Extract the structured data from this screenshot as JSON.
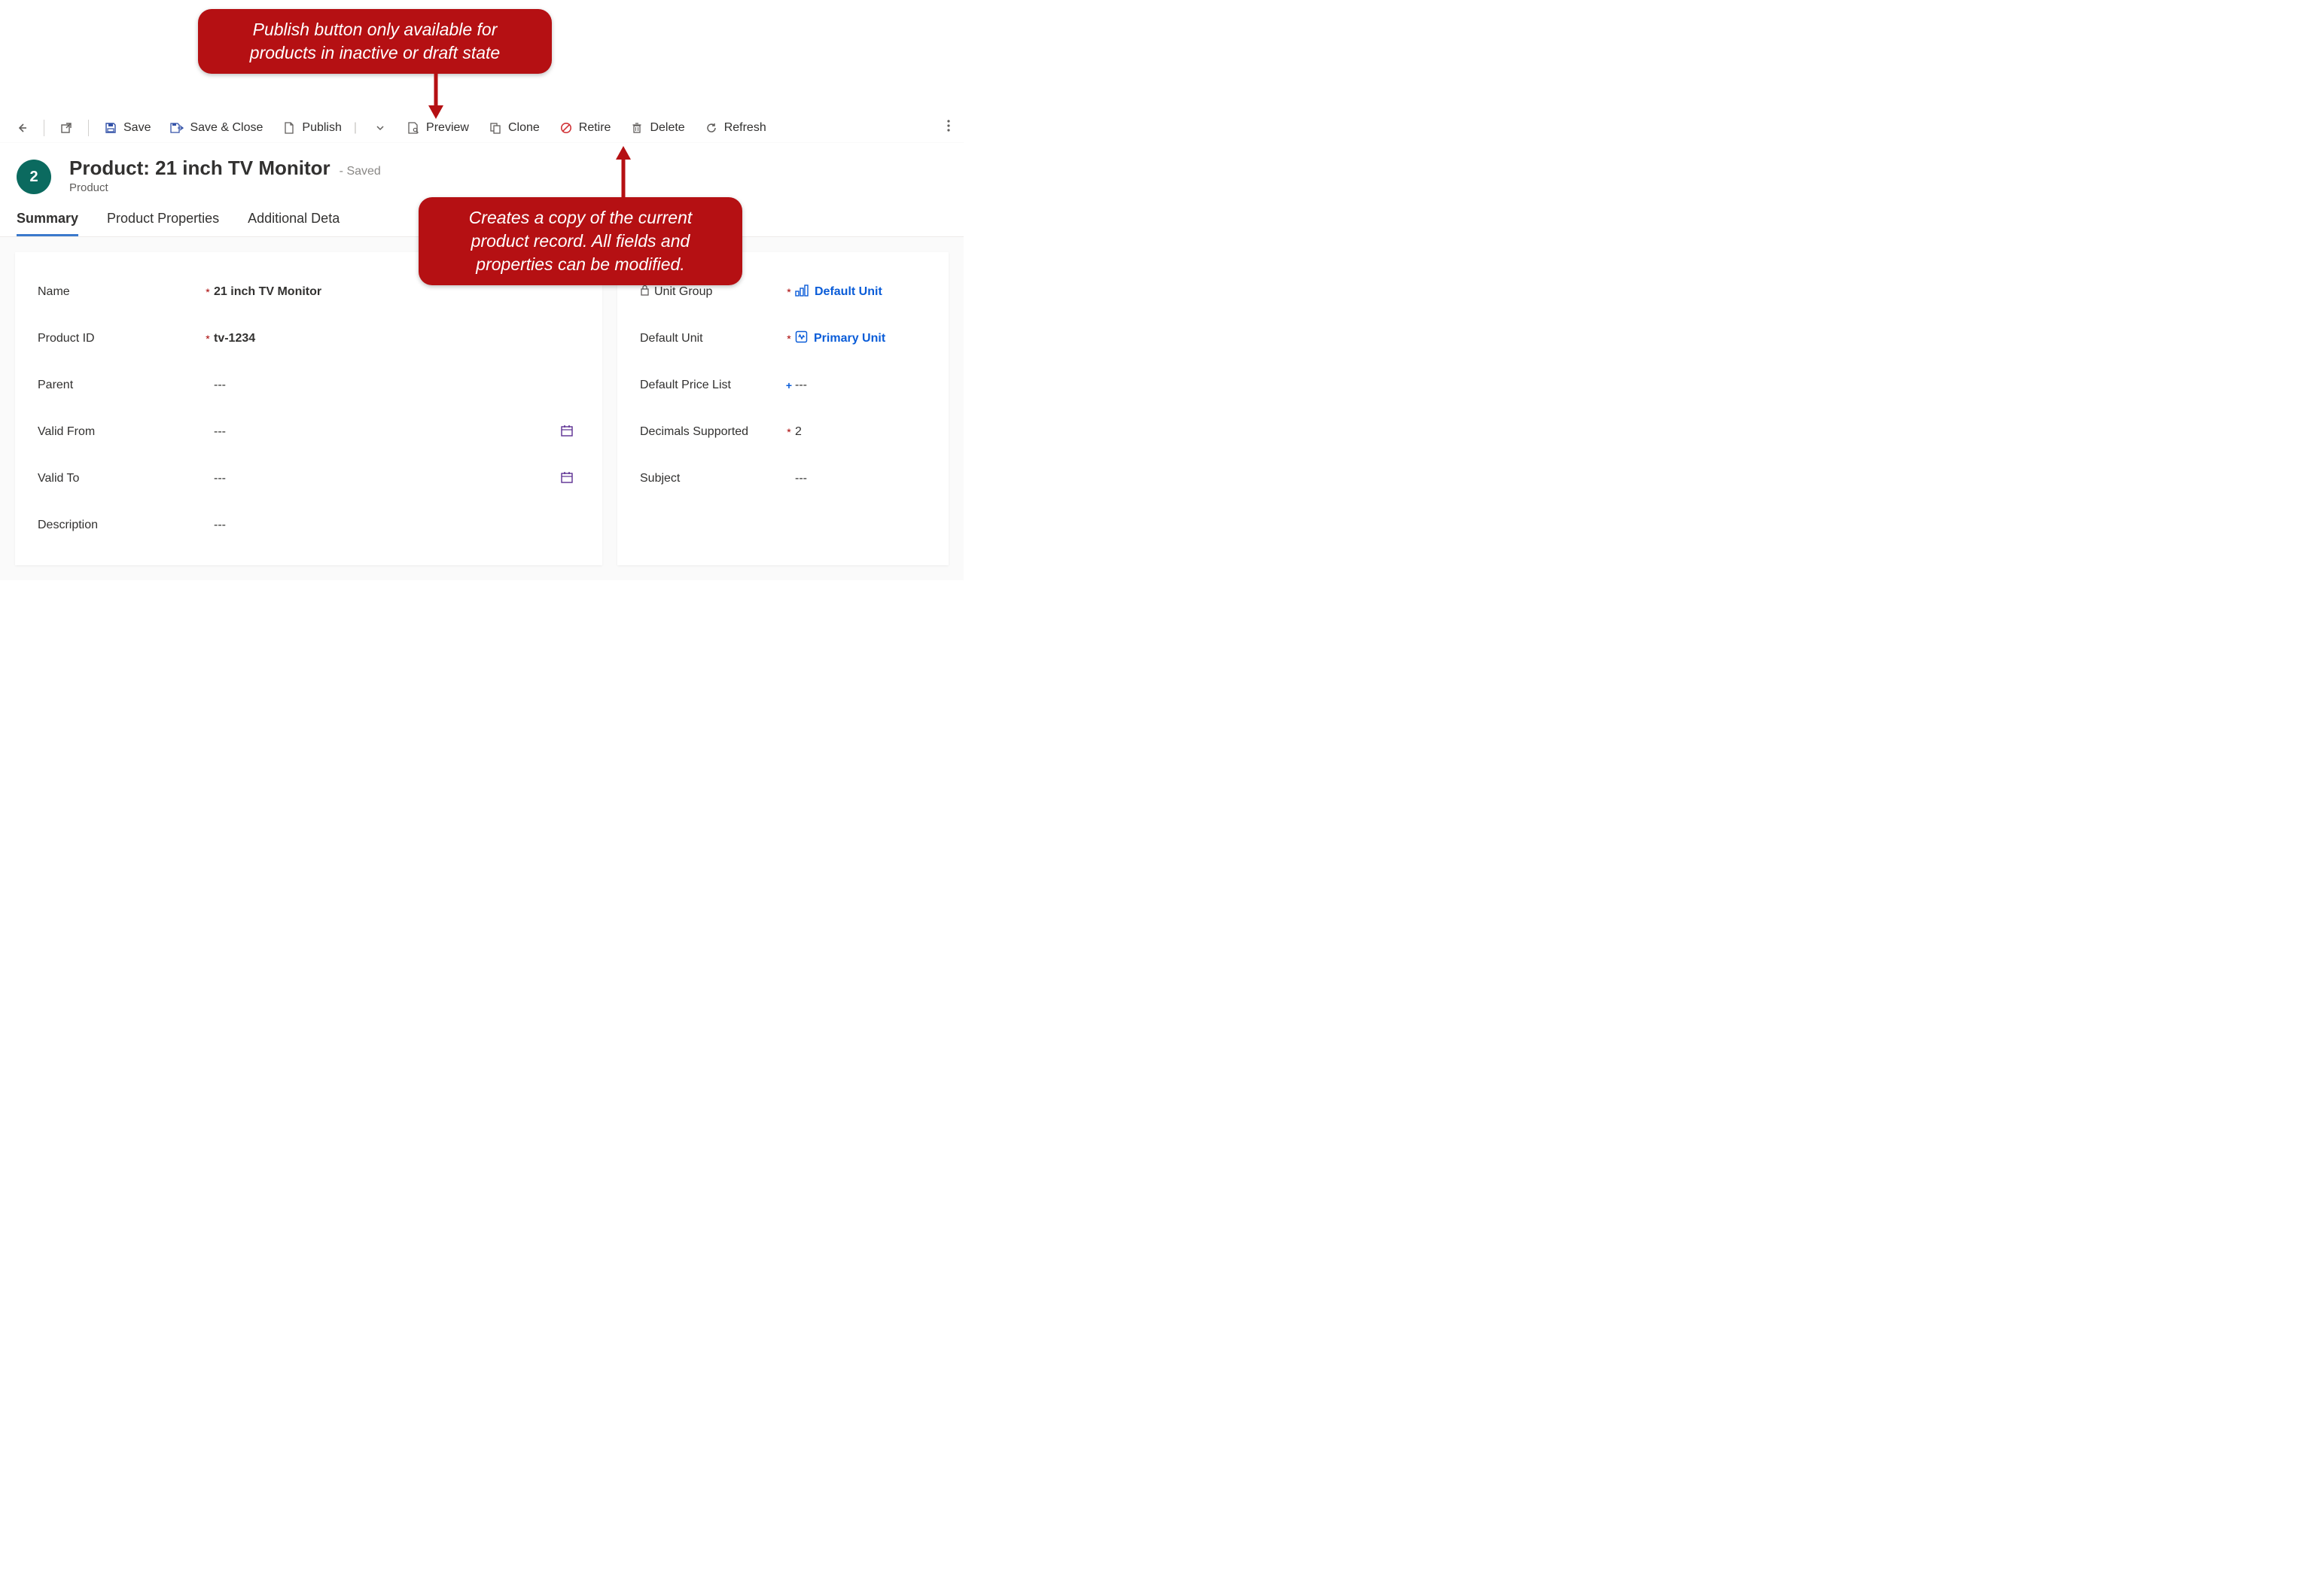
{
  "commands": {
    "save": "Save",
    "save_close": "Save & Close",
    "publish": "Publish",
    "preview": "Preview",
    "clone": "Clone",
    "retire": "Retire",
    "delete": "Delete",
    "refresh": "Refresh"
  },
  "header": {
    "stage_number": "2",
    "title": "Product: 21 inch TV Monitor",
    "status": "- Saved",
    "entity": "Product"
  },
  "tabs": {
    "summary": "Summary",
    "properties": "Product Properties",
    "details_partial": "Additional Deta"
  },
  "fields_left": {
    "name_label": "Name",
    "name_value": "21 inch TV Monitor",
    "pid_label": "Product ID",
    "pid_value": "tv-1234",
    "parent_label": "Parent",
    "parent_value": "---",
    "valid_from_label": "Valid From",
    "valid_from_value": "---",
    "valid_to_label": "Valid To",
    "valid_to_value": "---",
    "desc_label": "Description",
    "desc_value": "---"
  },
  "fields_right": {
    "unit_group_label": "Unit Group",
    "unit_group_value": "Default Unit",
    "default_unit_label": "Default Unit",
    "default_unit_value": "Primary Unit",
    "price_list_label": "Default Price List",
    "price_list_value": "---",
    "decimals_label": "Decimals Supported",
    "decimals_value": "2",
    "subject_label": "Subject",
    "subject_value": "---"
  },
  "callouts": {
    "top": "Publish button only available for products in inactive or draft state",
    "bottom": "Creates a copy of the current product record.  All fields and properties can be modified."
  }
}
